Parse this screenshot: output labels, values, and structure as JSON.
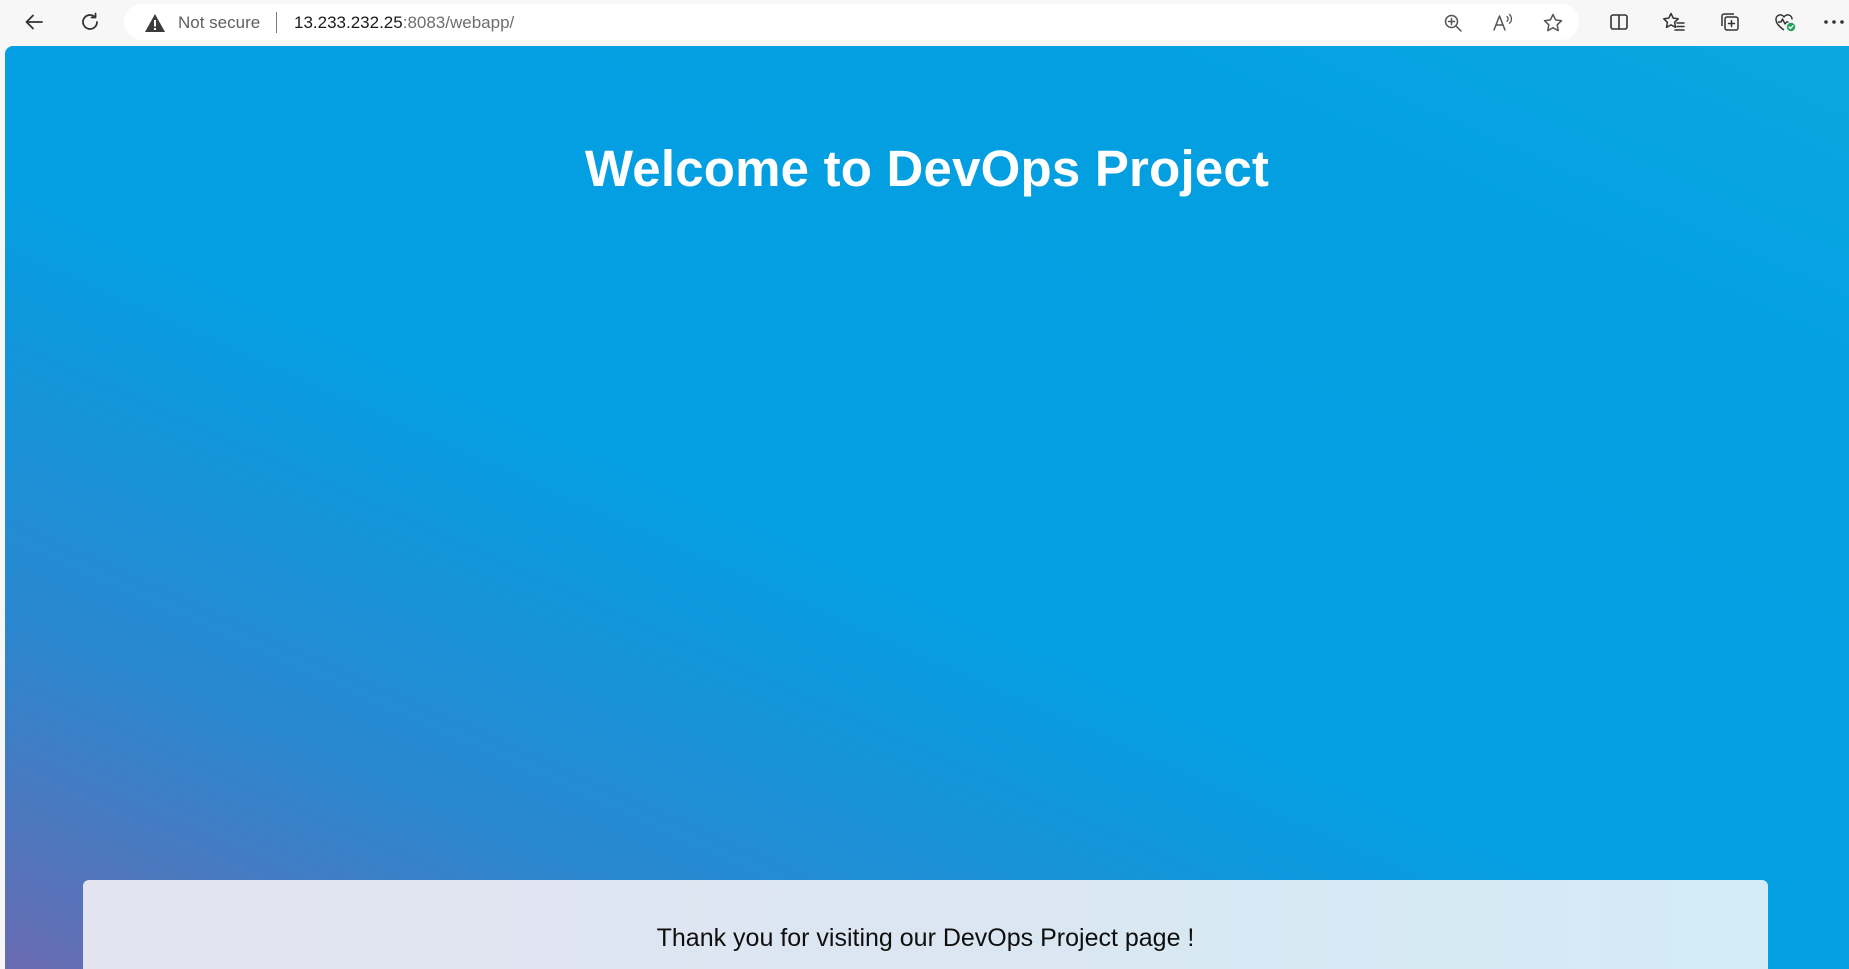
{
  "browser": {
    "security_label": "Not secure",
    "url_host": "13.233.232.25",
    "url_rest": ":8083/webapp/",
    "icons": {
      "back": "back-arrow-icon",
      "refresh": "refresh-icon",
      "warning": "warning-triangle-icon",
      "zoom": "zoom-in-icon",
      "read_aloud": "read-aloud-icon",
      "favorite": "star-icon",
      "split_screen": "split-screen-icon",
      "favorites": "favorites-icon",
      "collections": "collections-icon",
      "browser_essentials": "browser-essentials-icon",
      "more": "more-menu-icon"
    }
  },
  "page": {
    "title": "Welcome to DevOps Project",
    "footer_text": "Thank you for visiting our DevOps Project page !",
    "colors": {
      "gradient_top": "#0aa7e1",
      "gradient_mid": "#049fe2",
      "gradient_bottom_left": "#6a6bb1",
      "title": "#ffffff",
      "footer_card": "#dbe6f2"
    }
  }
}
